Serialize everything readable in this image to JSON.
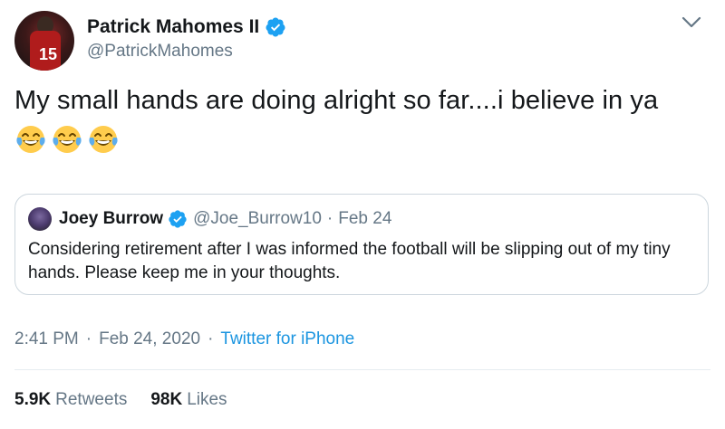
{
  "author": {
    "display_name": "Patrick Mahomes II",
    "handle": "@PatrickMahomes",
    "jersey_number": "15"
  },
  "tweet": {
    "text": "My small hands are doing alright so far....i believe in ya",
    "emojis": [
      "face-with-tears-of-joy",
      "face-with-tears-of-joy",
      "face-with-tears-of-joy"
    ]
  },
  "quoted": {
    "display_name": "Joey Burrow",
    "handle": "@Joe_Burrow10",
    "separator": "·",
    "date": "Feb 24",
    "text": "Considering retirement after I was informed the football will be slipping out of my tiny hands. Please keep me in your thoughts."
  },
  "meta": {
    "time": "2:41 PM",
    "dot1": "·",
    "date": "Feb 24, 2020",
    "dot2": "·",
    "source": "Twitter for iPhone"
  },
  "stats": {
    "retweets_count": "5.9K",
    "retweets_label": "Retweets",
    "likes_count": "98K",
    "likes_label": "Likes"
  },
  "colors": {
    "verified": "#1da1f2",
    "link": "#1b95e0",
    "secondary_text": "#657786",
    "primary_text": "#14171a",
    "border": "#ccd6dd"
  }
}
